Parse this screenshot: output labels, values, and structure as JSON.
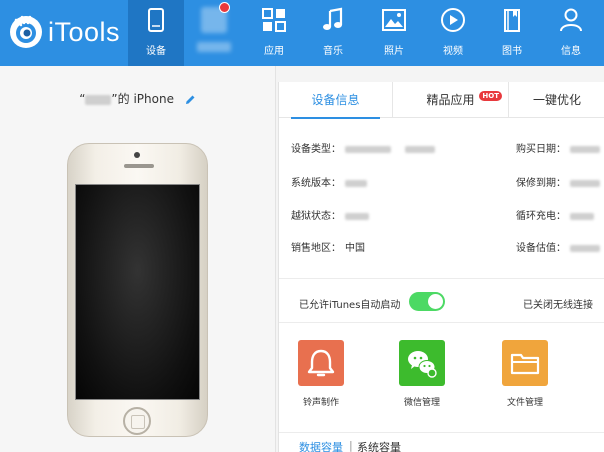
{
  "app": {
    "name": "iTools"
  },
  "nav": [
    {
      "id": "device",
      "label": "设备",
      "icon": "phone-icon",
      "active": true
    },
    {
      "id": "blurred",
      "label": "",
      "icon": "blurred-icon",
      "badge": true
    },
    {
      "id": "apps",
      "label": "应用",
      "icon": "apps-grid-icon"
    },
    {
      "id": "music",
      "label": "音乐",
      "icon": "music-note-icon"
    },
    {
      "id": "photos",
      "label": "照片",
      "icon": "photo-icon"
    },
    {
      "id": "video",
      "label": "视频",
      "icon": "play-icon"
    },
    {
      "id": "books",
      "label": "图书",
      "icon": "book-icon"
    },
    {
      "id": "info",
      "label": "信息",
      "icon": "user-icon"
    }
  ],
  "device": {
    "name_suffix": "”的 iPhone",
    "name_prefix": "“",
    "edit_icon": "pencil-icon"
  },
  "tabs": [
    {
      "label": "设备信息",
      "active": true
    },
    {
      "label": "精品应用",
      "badge": "HOT"
    },
    {
      "label": "一键优化"
    }
  ],
  "info": {
    "device_type_label": "设备类型：",
    "os_version_label": "系统版本：",
    "jailbreak_label": "越狱状态：",
    "region_label": "销售地区：",
    "region_value": "中国",
    "purchase_date_label": "购买日期：",
    "warranty_label": "保修到期：",
    "charge_cycles_label": "循环充电：",
    "valuation_label": "设备估值："
  },
  "itunes": {
    "label": "已允许iTunes自动启动",
    "toggle_on": true,
    "wifi_label": "已关闭无线连接"
  },
  "tools": [
    {
      "label": "铃声制作",
      "icon": "bell-icon",
      "color": "#e8704f"
    },
    {
      "label": "微信管理",
      "icon": "wechat-icon",
      "color": "#3dbb2d"
    },
    {
      "label": "文件管理",
      "icon": "folder-icon",
      "color": "#f0a53c"
    }
  ],
  "capacity": {
    "data_label": "数据容量",
    "divider": "|",
    "system_label": "系统容量"
  },
  "colors": {
    "brand_blue": "#2d8fe2",
    "active_nav": "#1f76c4",
    "toggle_green": "#4cd964",
    "badge_red": "#e8393d"
  }
}
